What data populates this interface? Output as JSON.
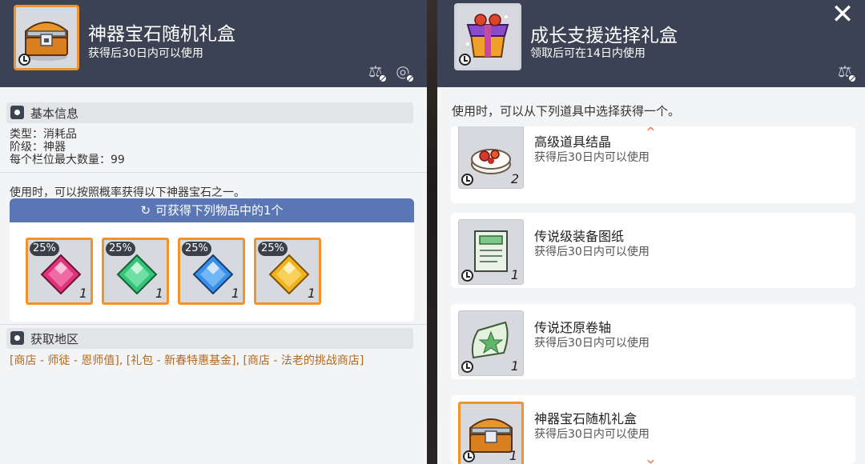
{
  "left": {
    "title": "神器宝石随机礼盒",
    "subtitle": "获得后30日内可以使用",
    "basic_info_title": "基本信息",
    "info": [
      "类型：消耗品",
      "阶级：神器",
      "每个栏位最大数量：99"
    ],
    "use_text": "使用时，可以按照概率获得以下神器宝石之一。",
    "reward_bar": "可获得下列物品中的1个",
    "gems": [
      {
        "pct": "25%",
        "count": "1",
        "color": "#e0337a",
        "icon": "magenta-gem-icon"
      },
      {
        "pct": "25%",
        "count": "1",
        "color": "#37c27a",
        "icon": "green-gem-icon"
      },
      {
        "pct": "25%",
        "count": "1",
        "color": "#3a8fe8",
        "icon": "blue-gem-icon"
      },
      {
        "pct": "25%",
        "count": "1",
        "color": "#f2b31c",
        "icon": "yellow-gem-icon"
      }
    ],
    "source_title": "获取地区",
    "source_text": "[商店 - 师徒 - 恩师值], [礼包 - 新春特惠基金], [商店 - 法老的挑战商店]"
  },
  "right": {
    "title": "成长支援选择礼盒",
    "subtitle": "领取后可在14日内使用",
    "use_text": "使用时，可以从下列道具中选择获得一个。",
    "items": [
      {
        "name": "高级道具结晶",
        "sub": "获得后30日内可以使用",
        "count": "2",
        "icon": "crystal-cake-icon"
      },
      {
        "name": "传说级装备图纸",
        "sub": "获得后30日内可以使用",
        "count": "1",
        "icon": "blueprint-scroll-icon"
      },
      {
        "name": "传说还原卷轴",
        "sub": "获得后30日内可以使用",
        "count": "1",
        "icon": "restore-scroll-icon"
      },
      {
        "name": "神器宝石随机礼盒",
        "sub": "获得后30日内可以使用",
        "count": "1",
        "icon": "treasure-chest-icon"
      }
    ]
  },
  "colors": {
    "header": "#3a4253",
    "accent_orange": "#f0932b",
    "reward_bar": "#5a76b5",
    "source_text": "#b3691e"
  }
}
